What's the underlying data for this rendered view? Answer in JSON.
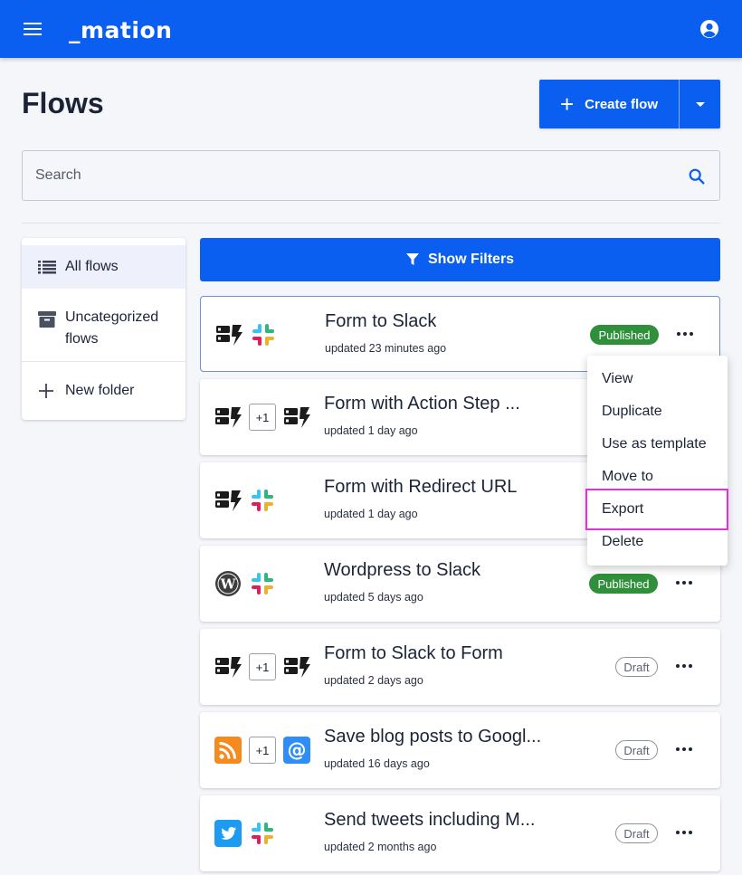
{
  "app": {
    "logo_text": "_mation"
  },
  "page": {
    "title": "Flows"
  },
  "create": {
    "label": "Create flow"
  },
  "search": {
    "placeholder": "Search",
    "value": ""
  },
  "sidebar": {
    "items": [
      {
        "label": "All flows",
        "icon": "list-icon",
        "active": true
      },
      {
        "label": "Uncategorized flows",
        "icon": "archive-icon",
        "active": false
      },
      {
        "label": "New folder",
        "icon": "plus-icon",
        "active": false
      }
    ]
  },
  "filters": {
    "label": "Show Filters"
  },
  "flows": [
    {
      "title": "Form to Slack",
      "updated": "updated 23 minutes ago",
      "status": "Published",
      "icons": [
        "form-icon",
        "slack-icon"
      ],
      "extra": ""
    },
    {
      "title": "Form with Action Step ...",
      "updated": "updated 1 day ago",
      "status": "",
      "icons": [
        "form-icon",
        "form-icon"
      ],
      "extra": "+1"
    },
    {
      "title": "Form with Redirect URL",
      "updated": "updated 1 day ago",
      "status": "",
      "icons": [
        "form-icon",
        "slack-icon"
      ],
      "extra": ""
    },
    {
      "title": "Wordpress to Slack",
      "updated": "updated 5 days ago",
      "status": "Published",
      "icons": [
        "wordpress-icon",
        "slack-icon"
      ],
      "extra": ""
    },
    {
      "title": "Form to Slack to Form",
      "updated": "updated 2 days ago",
      "status": "Draft",
      "icons": [
        "form-icon",
        "form-icon"
      ],
      "extra": "+1"
    },
    {
      "title": "Save blog posts to Googl...",
      "updated": "updated 16 days ago",
      "status": "Draft",
      "icons": [
        "rss-icon",
        "email-icon"
      ],
      "extra": "+1"
    },
    {
      "title": "Send tweets including M...",
      "updated": "updated 2 months ago",
      "status": "Draft",
      "icons": [
        "twitter-icon",
        "slack-icon"
      ],
      "extra": ""
    }
  ],
  "context_menu": {
    "items": [
      "View",
      "Duplicate",
      "Use as template",
      "Move to",
      "Export",
      "Delete"
    ],
    "highlighted": "Export"
  },
  "colors": {
    "primary": "#0a5ff0",
    "published": "#2f8f3a",
    "highlight": "#ee2ae0"
  }
}
